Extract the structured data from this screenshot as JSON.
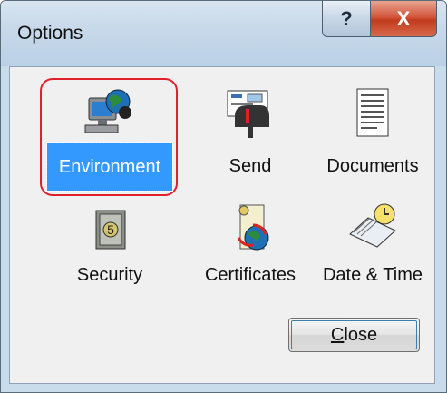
{
  "window": {
    "title": "Options"
  },
  "titlebar": {
    "help_glyph": "?",
    "close_glyph": "X"
  },
  "items": [
    {
      "label": "Environment",
      "icon": "environment-icon",
      "selected": true
    },
    {
      "label": "Send",
      "icon": "send-mailbox-icon"
    },
    {
      "label": "Documents",
      "icon": "documents-icon"
    },
    {
      "label": "Security",
      "icon": "safe-icon"
    },
    {
      "label": "Certificates",
      "icon": "certificate-icon"
    },
    {
      "label": "Date & Time",
      "icon": "calendar-clock-icon"
    }
  ],
  "close_button": {
    "mnemonic": "C",
    "rest": "lose"
  },
  "colors": {
    "selection": "#3399ff",
    "highlight_ring": "#e0202a"
  }
}
